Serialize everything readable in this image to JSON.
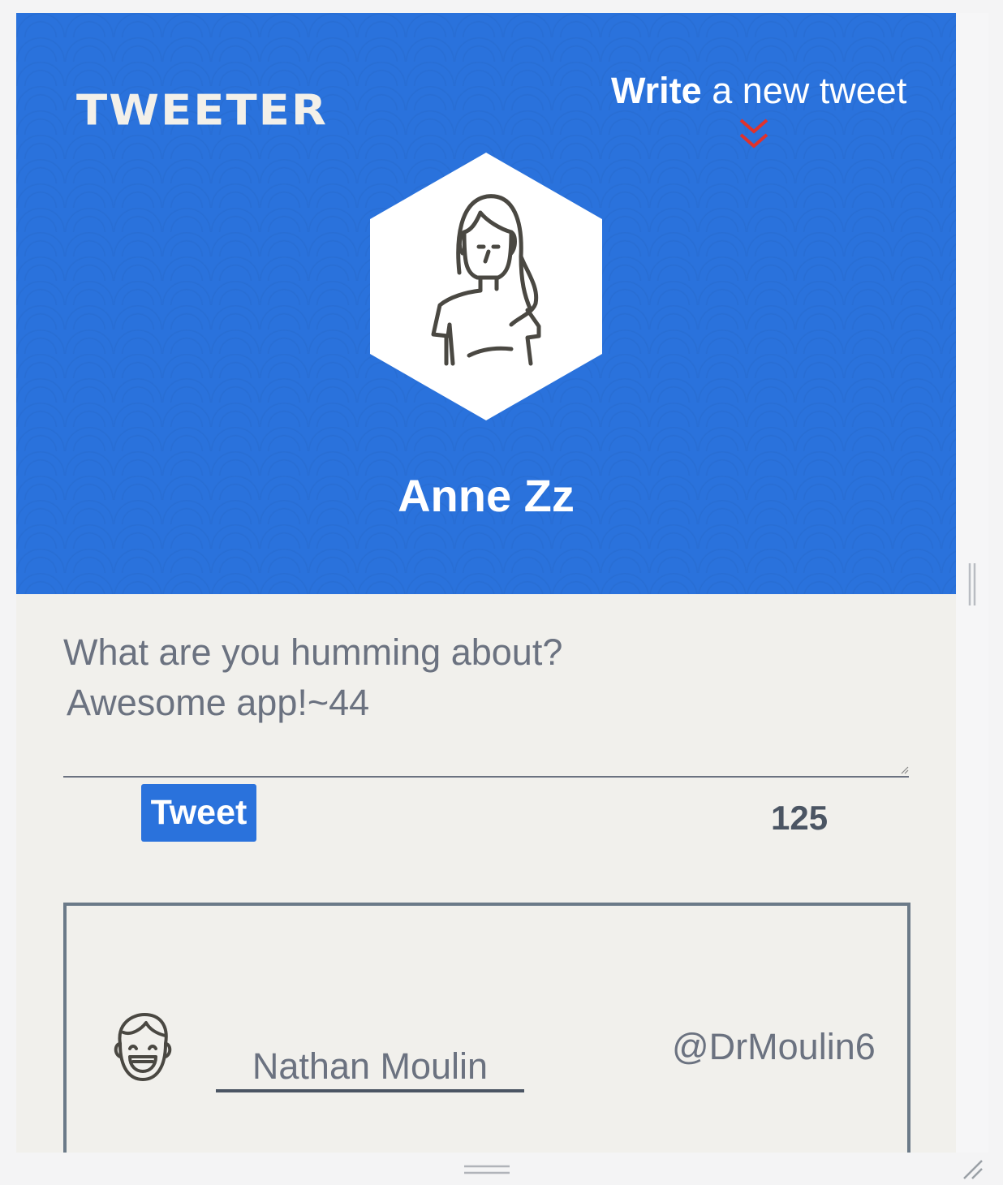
{
  "header": {
    "brand": "TWEETER",
    "write_strong": "Write",
    "write_rest": " a new tweet",
    "profile_name": "Anne Zz",
    "colors": {
      "background": "#2a72dc",
      "chevron": "#e0322c"
    }
  },
  "compose": {
    "placeholder": "What are you humming about?",
    "value": "Awesome app!~44",
    "tweet_button_label": "Tweet",
    "char_count": "125"
  },
  "tweets": [
    {
      "name": "Nathan Moulin",
      "handle": "@DrMoulin6",
      "avatar_icon": "smiling-man-avatar-icon"
    }
  ],
  "icons": {
    "profile_avatar": "woman-avatar-icon",
    "write_chevron": "double-chevron-down-icon"
  }
}
